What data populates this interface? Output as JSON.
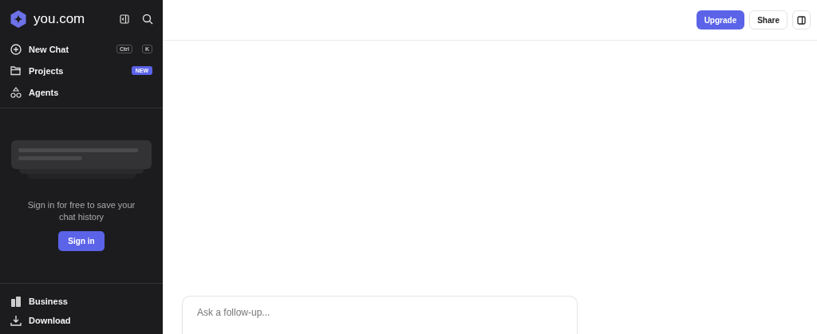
{
  "sidebar": {
    "logo": "you.com",
    "nav_items": [
      {
        "label": "New Chat",
        "kind": "shortcut",
        "keys": [
          "Ctrl",
          "K"
        ]
      },
      {
        "label": "Projects",
        "kind": "badge",
        "badge": "NEW"
      },
      {
        "label": "Agents",
        "kind": "plain"
      }
    ],
    "sign_in_prompt": "Sign in for free to save your chat history",
    "sign_in_button": "Sign in",
    "footer_items": [
      {
        "label": "Business"
      },
      {
        "label": "Download"
      }
    ]
  },
  "header": {
    "buttons": [
      {
        "label": "Upgrade",
        "kind": "primary"
      },
      {
        "label": "Share",
        "kind": "outline"
      }
    ]
  },
  "composer": {
    "placeholder": "Ask a follow-up..."
  }
}
